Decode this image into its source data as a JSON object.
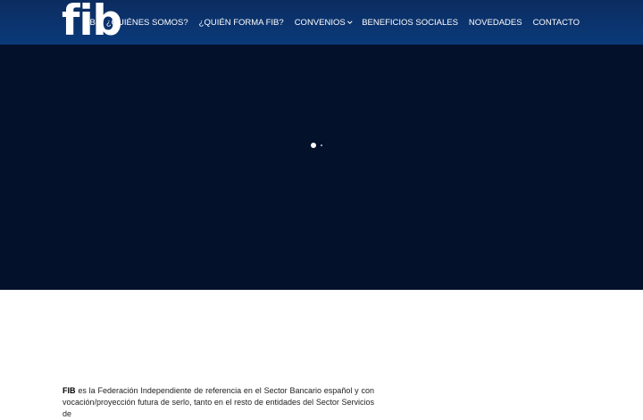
{
  "header": {
    "logo_text": "fib",
    "nav": [
      {
        "label": "FIB",
        "has_dropdown": false
      },
      {
        "label": "¿QUIÉNES SOMOS?",
        "has_dropdown": false
      },
      {
        "label": "¿QUIÉN FORMA FIB?",
        "has_dropdown": false
      },
      {
        "label": "CONVENIOS",
        "has_dropdown": true
      },
      {
        "label": "BENEFICIOS SOCIALES",
        "has_dropdown": false
      },
      {
        "label": "NOVEDADES",
        "has_dropdown": false
      },
      {
        "label": "CONTACTO",
        "has_dropdown": false
      }
    ]
  },
  "hero": {
    "slide_count": 2,
    "active_slide": 1
  },
  "intro": {
    "strong": "FIB",
    "text": " es la Federación Independiente de referencia en el Sector Bancario español y con vocación/proyección futura de serlo, tanto en el resto de entidades del Sector Servicios de"
  },
  "colors": {
    "header_bg": "#0c2c60",
    "hero_bg": "#03112a",
    "nav_text": "#ffffff"
  }
}
